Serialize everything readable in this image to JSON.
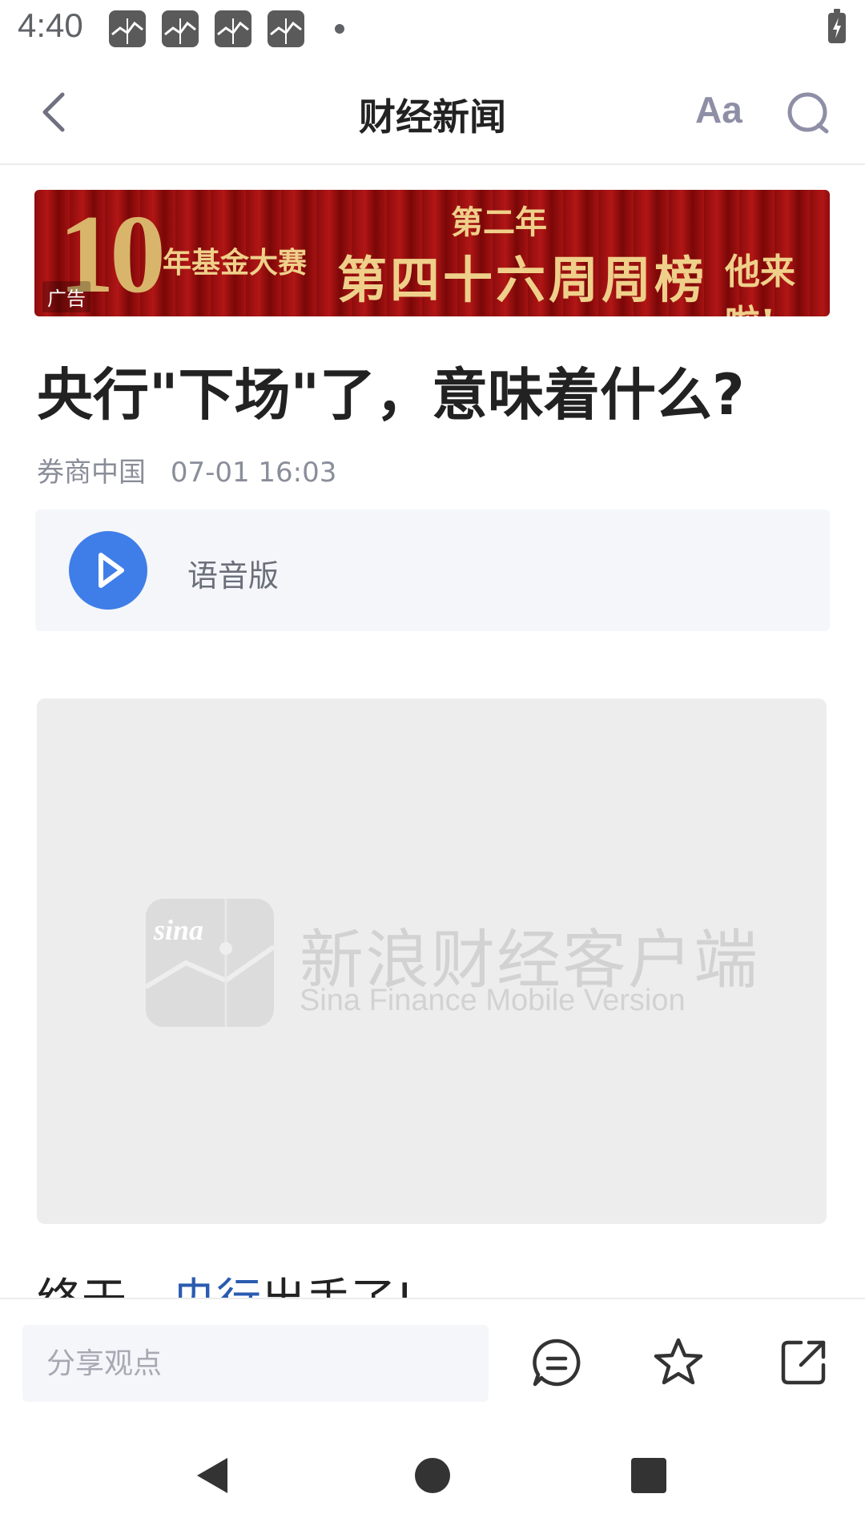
{
  "status_bar": {
    "time": "4:40",
    "notification_icons": [
      "sina-finance-icon",
      "sina-finance-icon",
      "sina-finance-icon",
      "sina-finance-icon"
    ],
    "battery": "battery-charging-icon"
  },
  "header": {
    "back_icon": "chevron-left-icon",
    "title": "财经新闻",
    "font_size_label": "Aa",
    "search_icon": "search-icon"
  },
  "ad": {
    "label": "广告",
    "big_number": "10",
    "line1": "年基金大赛",
    "line2": "第二年",
    "line3": "第四十六周周榜",
    "line4": "他来啦!"
  },
  "article": {
    "headline": "央行\"下场\"了，意味着什么?",
    "source": "券商中国",
    "timestamp": "07-01 16:03",
    "audio_label": "语音版",
    "image_watermark_cn": "新浪财经客户端",
    "image_watermark_en": "Sina Finance Mobile Version",
    "body_prefix": "终于，",
    "body_link": "央行",
    "body_suffix": "出手了!"
  },
  "bottom_bar": {
    "comment_placeholder": "分享观点",
    "icons": [
      "comment-icon",
      "star-icon",
      "share-icon"
    ]
  },
  "nav_bar": {
    "icons": [
      "back-triangle-icon",
      "home-circle-icon",
      "recents-square-icon"
    ]
  },
  "colors": {
    "accent_blue": "#3f7ee8",
    "link_blue": "#2b5bb0",
    "ad_red": "#a51212",
    "ad_gold": "#efd08a"
  }
}
